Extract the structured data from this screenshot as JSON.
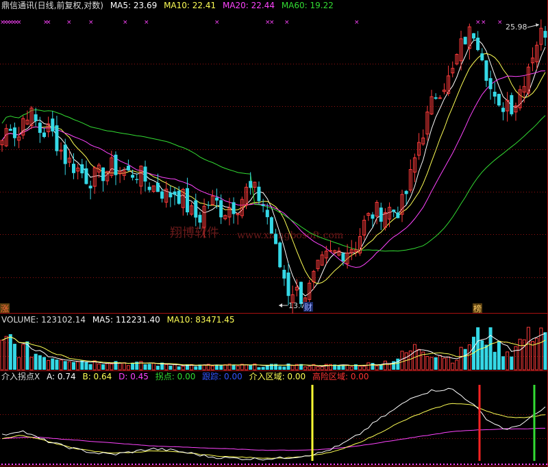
{
  "price_header": {
    "title": "鼎信通讯(日线,前复权,对数)",
    "ma5": "MA5: 23.69",
    "ma10": "MA10: 22.41",
    "ma20": "MA20: 22.44",
    "ma60": "MA60: 19.22"
  },
  "volume_header": {
    "title": "VOLUME: 123102.14",
    "ma5": "MA5: 112231.40",
    "ma10": "MA10: 83471.45"
  },
  "indicator_header": {
    "title": "介入拐点X",
    "a": "A: 0.74",
    "b": "B: 0.64",
    "d": "D: 0.45",
    "guaidian": "拐点: 0.00",
    "genzong": "跟踪: 0.00",
    "jieru": "介入区域: 0.00",
    "gaoxian": "高险区域: 0.00"
  },
  "annotations": {
    "high": "25.98",
    "low": "13.7",
    "badge_zhang": "涨",
    "badge_cai": "财",
    "badge_bang": "榜",
    "watermark_cn": "翔博软件",
    "watermark_url": "www.xiangbosoft.com"
  },
  "colors": {
    "up": "#ff3b3b",
    "down": "#35d8e6",
    "ma5": "#ffffff",
    "ma10": "#ffff55",
    "ma20": "#ff44ff",
    "ma60": "#33dd33",
    "grid": "#991111",
    "d_line": "#ff44ff",
    "marker_yellow": "#ffff33",
    "marker_red": "#ff2222",
    "marker_green": "#33dd33"
  },
  "chart_data": [
    {
      "type": "candlestick",
      "title": "鼎信通讯(日线,前复权,对数)",
      "scale": "log",
      "high": 25.98,
      "low": 13.7,
      "close_trend": [
        20.0,
        20.9,
        20.0,
        21.5,
        21.0,
        20.3,
        20.5,
        19.9,
        19.2,
        18.9,
        18.6,
        18.3,
        18.4,
        18.6,
        18.8,
        18.7,
        18.5,
        18.6,
        18.3,
        18.0,
        17.9,
        17.6,
        17.8,
        17.5,
        16.9,
        16.7,
        17.3,
        17.4,
        17.0,
        17.2,
        17.3,
        17.8,
        17.8,
        17.4,
        16.5,
        15.2,
        14.5,
        14.2,
        14.0,
        14.2,
        14.8,
        15.2,
        15.4,
        15.5,
        15.6,
        15.8,
        16.5,
        16.9,
        17.0,
        17.1,
        17.0,
        17.3,
        18.5,
        20.0,
        21.0,
        22.2,
        22.8,
        23.0,
        24.5,
        25.4,
        25.7,
        24.5,
        22.5,
        21.2,
        22.0,
        21.6,
        22.7,
        24.0,
        25.2,
        25.8
      ],
      "series": [
        {
          "name": "MA5",
          "last": 23.69
        },
        {
          "name": "MA10",
          "last": 22.41
        },
        {
          "name": "MA20",
          "last": 22.44
        },
        {
          "name": "MA60",
          "last": 19.22
        }
      ]
    },
    {
      "type": "bar",
      "title": "VOLUME",
      "last_volume": 123102.14,
      "series": [
        {
          "name": "MA5",
          "last": 112231.4
        },
        {
          "name": "MA10",
          "last": 83471.45
        }
      ],
      "relative_volume": [
        0.55,
        0.75,
        0.45,
        0.5,
        0.4,
        0.35,
        0.3,
        0.3,
        0.28,
        0.25,
        0.22,
        0.2,
        0.18,
        0.2,
        0.2,
        0.18,
        0.15,
        0.15,
        0.14,
        0.14,
        0.13,
        0.12,
        0.12,
        0.12,
        0.11,
        0.1,
        0.1,
        0.1,
        0.1,
        0.1,
        0.1,
        0.1,
        0.1,
        0.1,
        0.1,
        0.1,
        0.12,
        0.12,
        0.1,
        0.1,
        0.1,
        0.1,
        0.1,
        0.1,
        0.1,
        0.11,
        0.12,
        0.14,
        0.16,
        0.2,
        0.25,
        0.35,
        0.45,
        0.55,
        0.45,
        0.4,
        0.35,
        0.25,
        0.3,
        0.6,
        0.7,
        0.9,
        0.75,
        0.55,
        0.45,
        0.45,
        0.7,
        0.85,
        1.0,
        0.95
      ]
    },
    {
      "type": "line",
      "title": "介入拐点X",
      "series": [
        {
          "name": "A",
          "last": 0.74
        },
        {
          "name": "B",
          "last": 0.64
        },
        {
          "name": "D",
          "last": 0.45
        }
      ]
    }
  ]
}
